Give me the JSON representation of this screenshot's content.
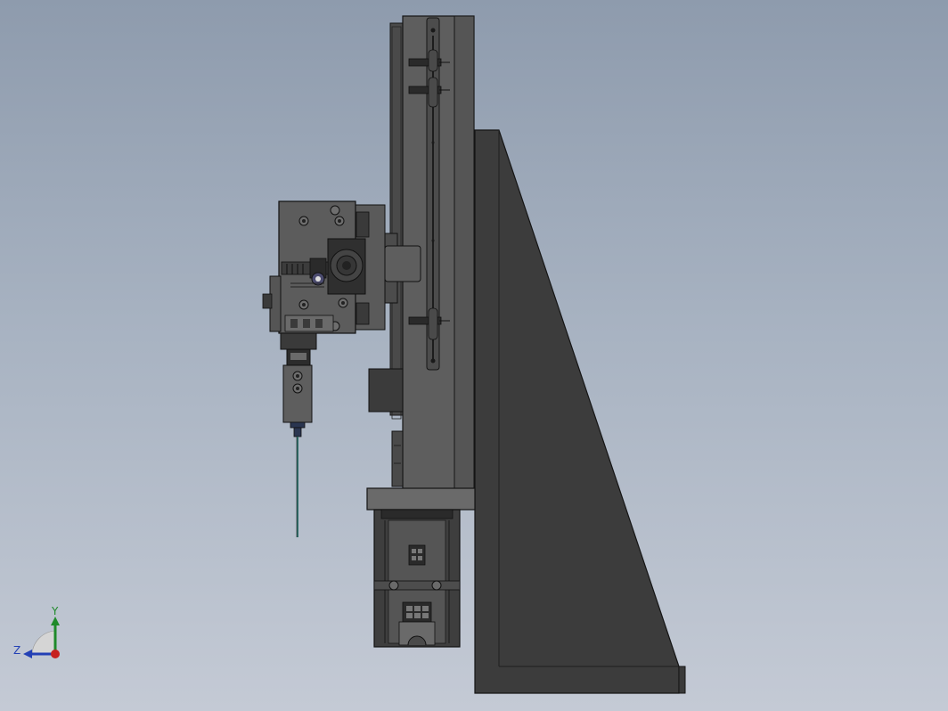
{
  "viewport": {
    "background_top": "#8e9bad",
    "background_bottom": "#c4cad5"
  },
  "model": {
    "description_icon": "cad-assembly-side-view",
    "colors": {
      "body": "#5b5b5b",
      "body_dark": "#3c3c3c",
      "edge": "#1a1a1a",
      "needle": "#2f6f6a"
    }
  },
  "triad": {
    "y_label": "Y",
    "z_label": "Z",
    "y_color": "#1f8a2a",
    "z_color": "#2340b5",
    "x_color": "#c62020"
  }
}
